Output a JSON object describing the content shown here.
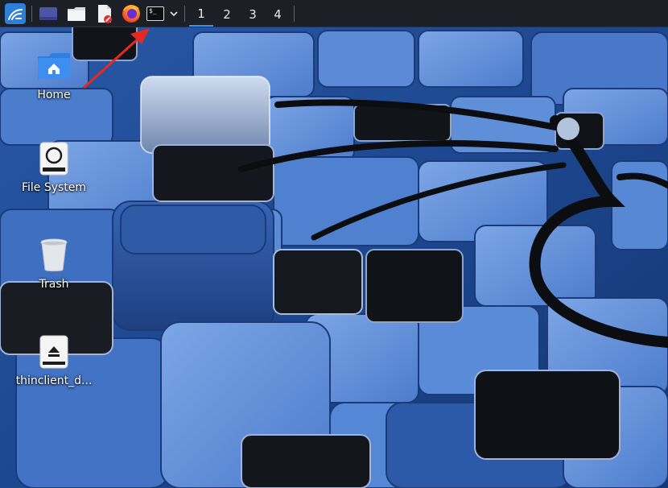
{
  "panel": {
    "launchers": [
      {
        "name": "kali-menu-icon"
      },
      {
        "name": "show-desktop-icon"
      },
      {
        "name": "file-manager-icon"
      },
      {
        "name": "text-editor-icon"
      },
      {
        "name": "firefox-icon"
      },
      {
        "name": "terminal-icon",
        "glyph": "$_"
      },
      {
        "name": "chevron-down-icon"
      }
    ],
    "workspaces": [
      "1",
      "2",
      "3",
      "4"
    ],
    "active_workspace": "1"
  },
  "desktop": {
    "icons": [
      {
        "label": "Home",
        "icon": "home-folder-icon"
      },
      {
        "label": "File System",
        "icon": "drive-icon"
      },
      {
        "label": "Trash",
        "icon": "trash-icon"
      },
      {
        "label": "thinclient_d...",
        "icon": "eject-drive-icon"
      }
    ]
  },
  "colors": {
    "panel_bg": "#1c1f26",
    "workspace_active": "#3b8fe6",
    "annotation_arrow": "#e8281e",
    "wallpaper_base": "#1d3f78"
  }
}
